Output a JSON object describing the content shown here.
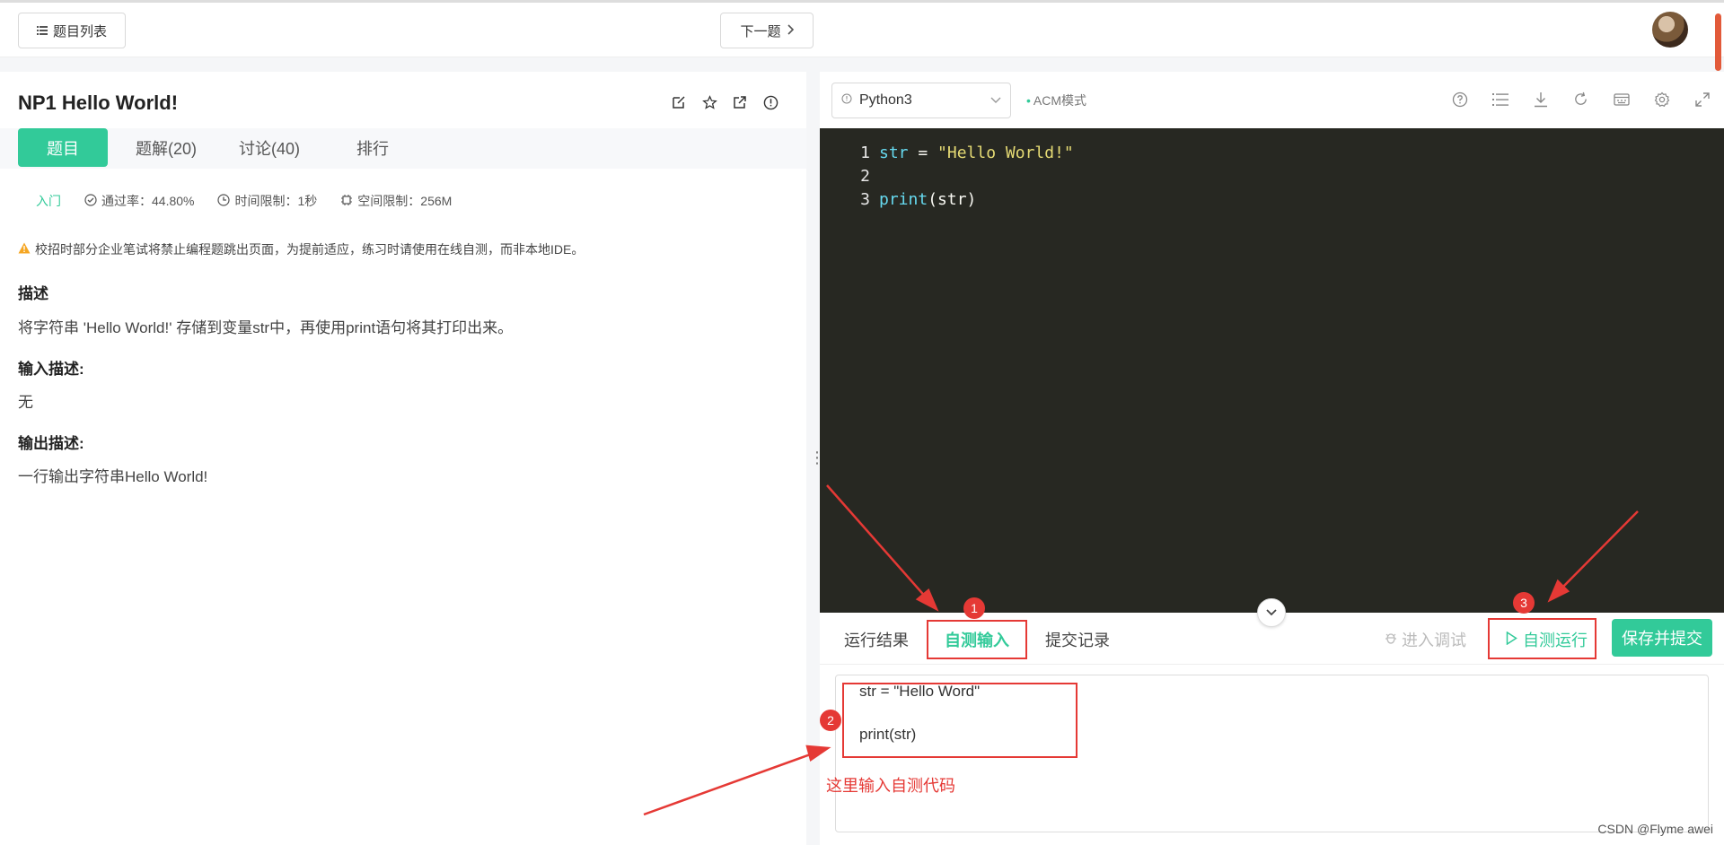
{
  "topbar": {
    "problem_list_label": "题目列表",
    "next_label": "下一题"
  },
  "problem": {
    "title": "NP1  Hello World!",
    "tabs": [
      {
        "label": "题目"
      },
      {
        "label": "题解(20)"
      },
      {
        "label": "讨论(40)"
      },
      {
        "label": "排行"
      }
    ],
    "difficulty": "入门",
    "pass_rate": "通过率：44.80%",
    "time_limit": "时间限制：1秒",
    "space_limit": "空间限制：256M",
    "notice": "校招时部分企业笔试将禁止编程题跳出页面，为提前适应，练习时请使用在线自测，而非本地IDE。",
    "description_heading": "描述",
    "description": "将字符串 'Hello World!' 存储到变量str中，再使用print语句将其打印出来。",
    "input_heading": "输入描述:",
    "input_text": "无",
    "output_heading": "输出描述:",
    "output_text": "一行输出字符串Hello World!"
  },
  "editor": {
    "language": "Python3",
    "mode": "ACM模式",
    "lines": [
      {
        "num": "1",
        "var": "str",
        "op": " = ",
        "str": "\"Hello World!\""
      },
      {
        "num": "2"
      },
      {
        "num": "3",
        "fn": "print",
        "rest": "(str)"
      }
    ]
  },
  "bottom": {
    "tab_result": "运行结果",
    "tab_input": "自测输入",
    "tab_records": "提交记录",
    "debug_label": "进入调试",
    "run_label": "自测运行",
    "submit_label": "保存并提交",
    "input_line1": "str = \"Hello Word\"",
    "input_line2": "print(str)",
    "annotation": "这里输入自测代码",
    "badge1": "1",
    "badge2": "2",
    "badge3": "3"
  },
  "watermark": "CSDN @Flyme awei",
  "colors": {
    "accent": "#32ca99",
    "annotation_red": "#e53935",
    "editor_bg": "#272822"
  }
}
